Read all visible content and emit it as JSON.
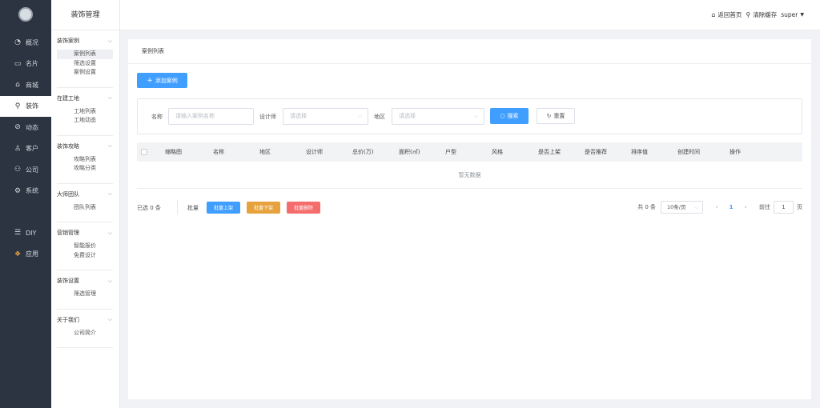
{
  "nav": {
    "items": [
      {
        "label": "概况",
        "icon": "pie-chart-icon",
        "glyph": "◔"
      },
      {
        "label": "名片",
        "icon": "card-icon",
        "glyph": "▭"
      },
      {
        "label": "商城",
        "icon": "shop-bag-icon",
        "glyph": "⌂"
      },
      {
        "label": "装饰",
        "icon": "decor-icon",
        "glyph": "⚲"
      },
      {
        "label": "动态",
        "icon": "compass-icon",
        "glyph": "⊘"
      },
      {
        "label": "客户",
        "icon": "user-icon",
        "glyph": "♙"
      },
      {
        "label": "公司",
        "icon": "org-icon",
        "glyph": "⚇"
      },
      {
        "label": "系统",
        "icon": "settings-icon",
        "glyph": "⚙"
      }
    ],
    "extra": [
      {
        "label": "DIY",
        "icon": "diy-icon",
        "glyph": "☰"
      },
      {
        "label": "应用",
        "icon": "apps-icon",
        "glyph": "❖"
      }
    ]
  },
  "sub": {
    "title": "装饰管理",
    "groups": [
      {
        "title": "装饰案例",
        "items": [
          "案例列表",
          "筛选设置",
          "案例设置"
        ]
      },
      {
        "title": "在建工地",
        "items": [
          "工地列表",
          "工地动态"
        ]
      },
      {
        "title": "装饰攻略",
        "items": [
          "攻略列表",
          "攻略分类"
        ]
      },
      {
        "title": "大师团队",
        "items": [
          "团队列表"
        ]
      },
      {
        "title": "营销管理",
        "items": [
          "智能报价",
          "免费设计"
        ]
      },
      {
        "title": "装饰设置",
        "items": [
          "筛选管理"
        ]
      },
      {
        "title": "关于我们",
        "items": [
          "公司简介"
        ]
      }
    ]
  },
  "header": {
    "home": "返回首页",
    "clear_cache": "清除缓存",
    "user": "super"
  },
  "main": {
    "breadcrumb": "案例列表",
    "add_button": "添加案例",
    "filter": {
      "name_label": "名称",
      "name_placeholder": "请输入案例名称",
      "designer_label": "设计师",
      "designer_placeholder": "请选择",
      "region_label": "地区",
      "region_placeholder": "请选择",
      "search": "搜索",
      "reset": "重置"
    },
    "columns": [
      "缩略图",
      "名称",
      "地区",
      "设计师",
      "总价(万)",
      "面积(㎡)",
      "户型",
      "风格",
      "是否上架",
      "是否推荐",
      "排序值",
      "创建时间",
      "操作"
    ],
    "empty_text": "暂无数据",
    "selected_text": "已选 0 条",
    "batch_label": "批量",
    "batch_buttons": [
      "批量上架",
      "批量下架",
      "批量删除"
    ],
    "pager": {
      "total": "共 0 条",
      "page_size": "10条/页",
      "current": "1",
      "goto": "前往",
      "goto_value": "1",
      "page_unit": "页"
    }
  },
  "colors": {
    "primary": "#409eff",
    "warning": "#e6a23c",
    "danger": "#f56c6c",
    "nav_bg": "#2b3440"
  }
}
